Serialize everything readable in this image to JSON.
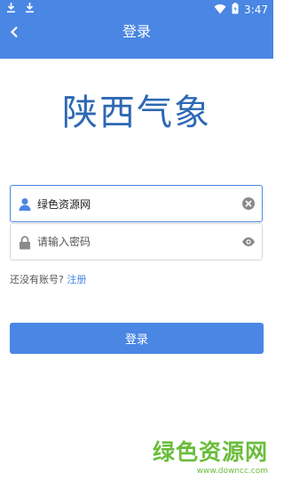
{
  "status_bar": {
    "time": "3:47",
    "icons": [
      "download-icon",
      "download-icon",
      "wifi-icon",
      "battery-icon"
    ]
  },
  "toolbar": {
    "title": "登录",
    "back_icon": "chevron-left-icon"
  },
  "logo_text": "陕西气象",
  "account_field": {
    "value": "绿色资源网",
    "icon": "person-icon",
    "action_icon": "clear-icon"
  },
  "password_field": {
    "placeholder": "请输入密码",
    "icon": "lock-icon",
    "action_icon": "eye-icon"
  },
  "signup": {
    "prompt": "还没有账号?",
    "link": "注册"
  },
  "login_button": {
    "label": "登录"
  },
  "watermark": {
    "text": "绿色资源网",
    "url": "www.downcc.com"
  },
  "colors": {
    "primary": "#4a86e3",
    "logo": "#2d68b3",
    "watermark": "#6bbd3c"
  }
}
